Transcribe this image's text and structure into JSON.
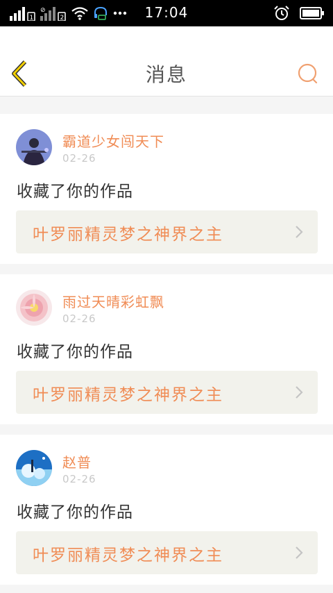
{
  "status_bar": {
    "time": "17:04",
    "icons": [
      "signal-1-icon",
      "signal-2-icon",
      "wifi-icon",
      "headset-icon",
      "more-dots-icon",
      "alarm-icon",
      "battery-icon"
    ]
  },
  "header": {
    "title": "消息",
    "back_icon": "chevron-left-icon",
    "search_icon": "search-icon"
  },
  "messages": [
    {
      "username": "霸道少女闯天下",
      "date": "02-26",
      "action": "收藏了你的作品",
      "work_title": "叶罗丽精灵梦之神界之主"
    },
    {
      "username": "雨过天晴彩虹飘",
      "date": "02-26",
      "action": "收藏了你的作品",
      "work_title": "叶罗丽精灵梦之神界之主"
    },
    {
      "username": "赵普",
      "date": "02-26",
      "action": "收藏了你的作品",
      "work_title": "叶罗丽精灵梦之神界之主"
    }
  ],
  "colors": {
    "accent": "#f08c55",
    "back_icon": "#e8b800",
    "card_box": "#f2f2ec",
    "page_bg": "#f5f5f5"
  }
}
